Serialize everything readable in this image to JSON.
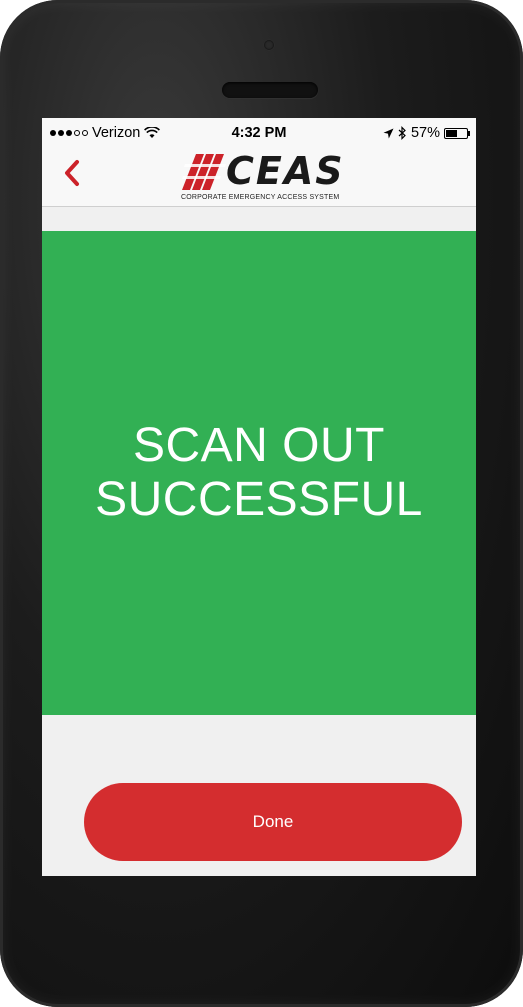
{
  "status_bar": {
    "carrier": "Verizon",
    "time": "4:32 PM",
    "battery": "57%",
    "battery_level": 0.57
  },
  "nav": {
    "back_icon": "chevron-left-icon",
    "logo_text": "CEAS",
    "logo_subtitle": "CORPORATE EMERGENCY ACCESS SYSTEM"
  },
  "result": {
    "line1": "SCAN OUT",
    "line2": "SUCCESSFUL",
    "color": "#32b054"
  },
  "actions": {
    "done_label": "Done",
    "done_color": "#d42d2f"
  },
  "colors": {
    "accent": "#cc2229"
  }
}
